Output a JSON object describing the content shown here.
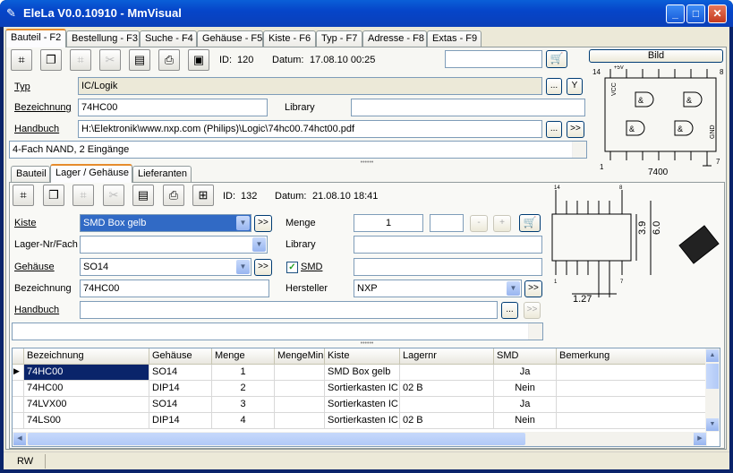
{
  "window": {
    "title": "EleLa V0.0.10910  - MmVisual",
    "icon": "pencil-icon",
    "minimize": "_",
    "maximize": "□",
    "close": "✕"
  },
  "main_tabs": [
    {
      "label": "Bauteil - F2"
    },
    {
      "label": "Bestellung - F3"
    },
    {
      "label": "Suche - F4"
    },
    {
      "label": "Gehäuse - F5"
    },
    {
      "label": "Kiste - F6"
    },
    {
      "label": "Typ - F7"
    },
    {
      "label": "Adresse - F8"
    },
    {
      "label": "Extas - F9"
    }
  ],
  "part": {
    "id_label": "ID:",
    "id_value": "120",
    "date_label": "Datum:",
    "date_value": "17.08.10 00:25",
    "typ_label": "Typ",
    "typ_value": "IC/Logik",
    "typ_btn": "...",
    "typ_btn2": "Y",
    "bezeichnung_label": "Bezeichnung",
    "bezeichnung_value": "74HC00",
    "library_label": "Library",
    "library_value": "",
    "handbuch_label": "Handbuch",
    "handbuch_value": "H:\\Elektronik\\www.nxp.com (Philips)\\Logic\\74hc00.74hct00.pdf",
    "handbuch_btn": "...",
    "handbuch_go": ">>",
    "description": "4-Fach NAND, 2 Eingänge",
    "bild_btn": "Bild",
    "search_value": ""
  },
  "chip_image": {
    "vcc": "VCC",
    "gnd": "GND",
    "plus5v": "+5V",
    "name": "7400",
    "pin14": "14",
    "pin8": "8",
    "pin1": "1",
    "pin7": "7",
    "gate": "&"
  },
  "sub_tabs": [
    {
      "label": "Bauteil"
    },
    {
      "label": "Lager / Gehäuse"
    },
    {
      "label": "Lieferanten"
    }
  ],
  "stock": {
    "id_label": "ID:",
    "id_value": "132",
    "date_label": "Datum:",
    "date_value": "21.08.10 18:41",
    "kiste_label": "Kiste",
    "kiste_value": "SMD Box gelb",
    "lagernr_label": "Lager-Nr/Fach",
    "lagernr_value": "",
    "gehaeuse_label": "Gehäuse",
    "gehaeuse_value": "SO14",
    "bezeichnung_label": "Bezeichnung",
    "bezeichnung_value": "74HC00",
    "handbuch_label": "Handbuch",
    "handbuch_value": "",
    "menge_label": "Menge",
    "menge_value": "1",
    "menge_delta": "",
    "minus": "-",
    "plus": "+",
    "library_label": "Library",
    "library_value": "",
    "smd_label": "SMD",
    "smd_checked": true,
    "smd_value": "",
    "hersteller_label": "Hersteller",
    "hersteller_value": "NXP",
    "go": ">>",
    "dots": "..."
  },
  "package_image": {
    "pin14": "14",
    "pin8": "8",
    "pin1": "1",
    "pin7": "7",
    "dim_width": "3.9",
    "dim_total": "6.0",
    "dim_pitch": "1.27"
  },
  "table": {
    "columns": [
      "Bezeichnung",
      "Gehäuse",
      "Menge",
      "MengeMin",
      "Kiste",
      "Lagernr",
      "SMD",
      "Bemerkung"
    ],
    "rows": [
      [
        "74HC00",
        "SO14",
        "1",
        "",
        "SMD Box gelb",
        "",
        "Ja",
        ""
      ],
      [
        "74HC00",
        "DIP14",
        "2",
        "",
        "Sortierkasten IC",
        "02 B",
        "Nein",
        ""
      ],
      [
        "74LVX00",
        "SO14",
        "3",
        "",
        "Sortierkasten IC",
        "",
        "Ja",
        ""
      ],
      [
        "74LS00",
        "DIP14",
        "4",
        "",
        "Sortierkasten IC",
        "02 B",
        "Nein",
        ""
      ]
    ]
  },
  "status": {
    "mode": "RW"
  }
}
